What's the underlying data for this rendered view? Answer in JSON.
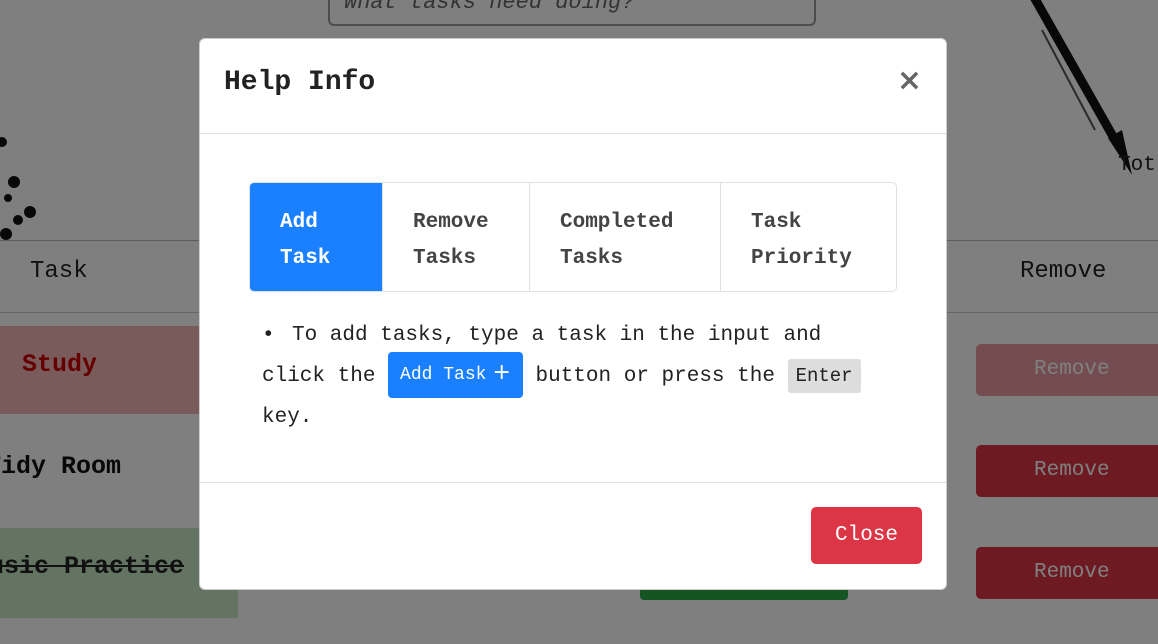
{
  "background": {
    "task_input_placeholder": "What tasks need doing?",
    "columns": {
      "task": "Task",
      "remove": "Remove"
    },
    "total_label": "Tot",
    "rows": [
      {
        "task": "Study",
        "remove": "Remove",
        "style": "priority"
      },
      {
        "task": "Tidy Room",
        "remove": "Remove",
        "style": "normal"
      },
      {
        "task": "Music Practice",
        "remove": "Remove",
        "style": "completed"
      }
    ]
  },
  "modal": {
    "title": "Help Info",
    "close_x": "×",
    "tabs": [
      {
        "line1": "Add",
        "line2": "Task",
        "active": true
      },
      {
        "line1": "Remove",
        "line2": "Tasks",
        "active": false
      },
      {
        "line1": "Completed",
        "line2": "Tasks",
        "active": false
      },
      {
        "line1": "Task",
        "line2": "Priority",
        "active": false
      }
    ],
    "body": {
      "bullet": "•",
      "text_before": "To add tasks, type a task in the input and click the",
      "inline_button": "Add Task",
      "inline_button_icon": "+",
      "text_middle": "button or press the",
      "key": "Enter",
      "text_after": "key."
    },
    "close_button": "Close"
  },
  "colors": {
    "primary": "#1a80ff",
    "danger": "#dc3545",
    "success": "#28a745"
  }
}
